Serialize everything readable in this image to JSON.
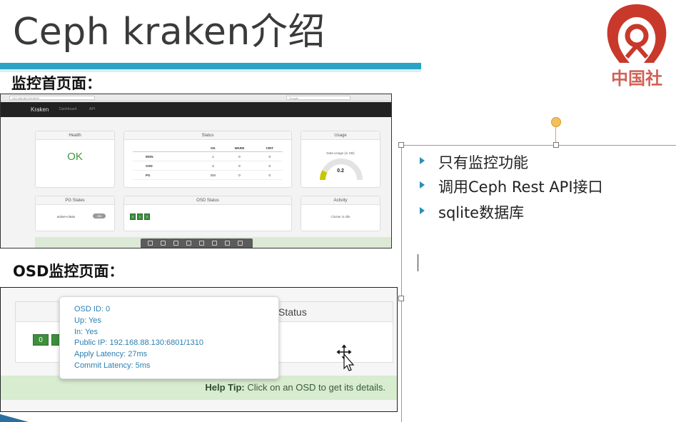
{
  "slide": {
    "title": "Ceph kraken介绍",
    "section1": "监控首页面：",
    "section2": "OSD监控页面：",
    "logo_text": "中国社"
  },
  "dashboard": {
    "url": "192.168.88.130:5000",
    "search_placeholder": "Google",
    "brand": "Kraken",
    "nav": [
      "Dashboard",
      "API"
    ],
    "panels": {
      "health": {
        "title": "Health",
        "value": "OK"
      },
      "status": {
        "title": "Status",
        "columns": [
          "",
          "OK",
          "WARN",
          "CRIT"
        ],
        "rows": [
          {
            "label": "MON",
            "ok": "1",
            "warn": "0",
            "crit": "0"
          },
          {
            "label": "OSD",
            "ok": "3",
            "warn": "0",
            "crit": "0"
          },
          {
            "label": "PG",
            "ok": "250",
            "warn": "0",
            "crit": "0"
          }
        ]
      },
      "usage": {
        "title": "Usage",
        "label": "Data Usage (in GB)",
        "value": "0.2",
        "fill": 0.15
      },
      "pg_states": {
        "title": "PG States",
        "state": "active+clean",
        "count": "256"
      },
      "osd_status": {
        "title": "OSD Status",
        "osds": [
          "0",
          "1",
          "2"
        ]
      },
      "activity": {
        "title": "Activity",
        "text": "Cluster is idle"
      }
    }
  },
  "osd_view": {
    "panel_title": "Status",
    "osd_box": "0",
    "tooltip": {
      "osd_id": "OSD ID: 0",
      "up": "Up: Yes",
      "in": "In: Yes",
      "public_ip": "Public IP: 192.168.88.130:6801/1310",
      "apply_latency": "Apply Latency: 27ms",
      "commit_latency": "Commit Latency: 5ms"
    },
    "help_label": "Help Tip:",
    "help_text": "Click on an OSD to get its details."
  },
  "bullets": [
    "只有监控功能",
    "调用Ceph Rest API接口",
    "sqlite数据库"
  ],
  "colors": {
    "accent": "#2aa3c6",
    "bullet": "#2a8fb5",
    "ok_green": "#3c9a3c",
    "tooltip_text": "#2b7fb0",
    "logo_red": "#c8392b"
  }
}
